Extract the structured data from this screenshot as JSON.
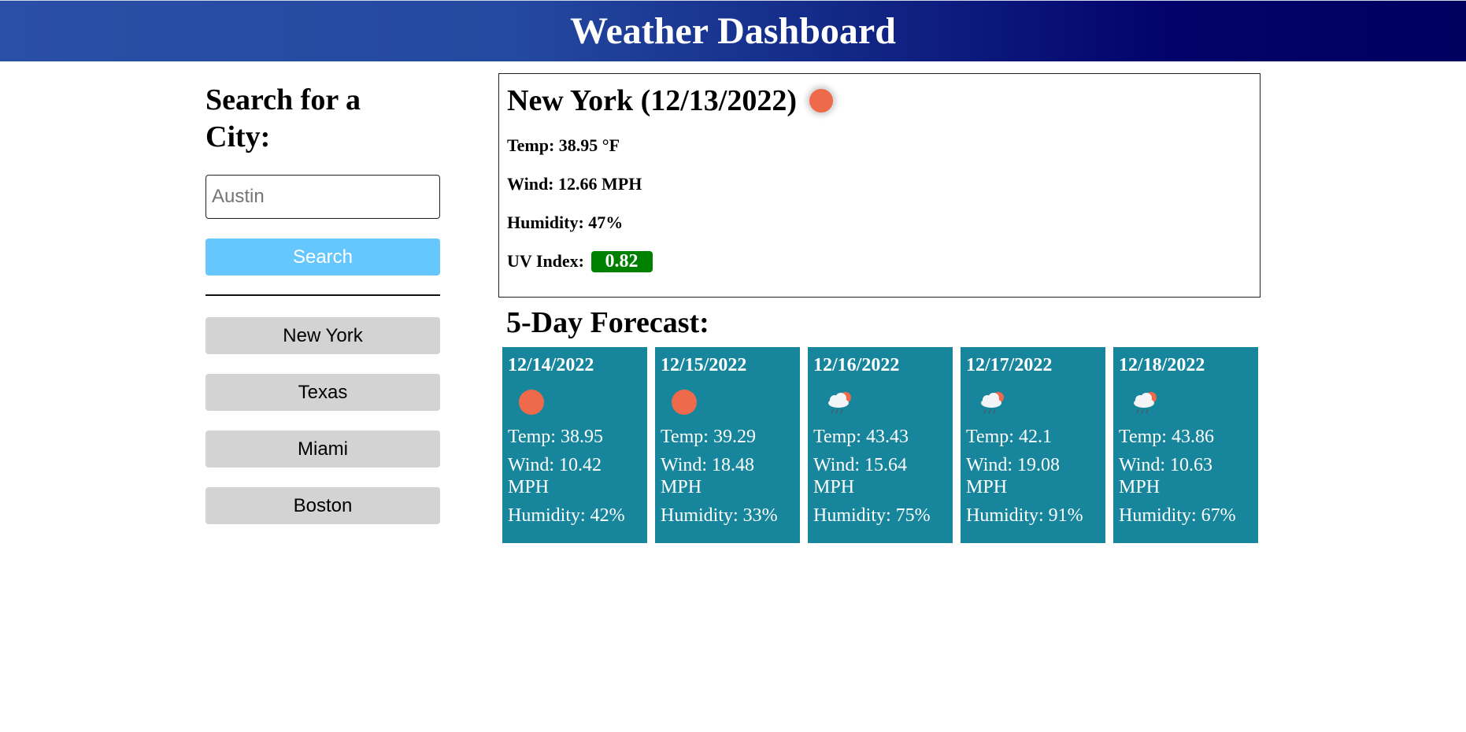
{
  "header": {
    "title": "Weather Dashboard"
  },
  "sidebar": {
    "title": "Search for a City:",
    "search_placeholder": "Austin",
    "search_button": "Search",
    "history": [
      "New York",
      "Texas",
      "Miami",
      "Boston"
    ]
  },
  "current": {
    "title": "New York (12/13/2022)",
    "icon": "sun-icon",
    "temp": "Temp: 38.95 °F",
    "wind": "Wind: 12.66 MPH",
    "humidity": "Humidity: 47%",
    "uv_label": "UV Index:",
    "uv_value": "0.82",
    "uv_color": "#008000"
  },
  "forecast": {
    "title": "5-Day Forecast:",
    "days": [
      {
        "date": "12/14/2022",
        "icon": "sun-icon",
        "temp": "Temp: 38.95",
        "wind": "Wind: 10.42 MPH",
        "humidity": "Humidity: 42%"
      },
      {
        "date": "12/15/2022",
        "icon": "sun-icon",
        "temp": "Temp: 39.29",
        "wind": "Wind: 18.48 MPH",
        "humidity": "Humidity: 33%"
      },
      {
        "date": "12/16/2022",
        "icon": "rain-cloud-icon",
        "temp": "Temp: 43.43",
        "wind": "Wind: 15.64 MPH",
        "humidity": "Humidity: 75%"
      },
      {
        "date": "12/17/2022",
        "icon": "rain-cloud-icon",
        "temp": "Temp: 42.1",
        "wind": "Wind: 19.08 MPH",
        "humidity": "Humidity: 91%"
      },
      {
        "date": "12/18/2022",
        "icon": "rain-cloud-icon",
        "temp": "Temp: 43.86",
        "wind": "Wind: 10.63 MPH",
        "humidity": "Humidity: 67%"
      }
    ],
    "card_color": "#17869c"
  },
  "colors": {
    "accent": "#66c7ff",
    "sun": "#ee6a4b",
    "history_button": "#d3d3d3"
  }
}
